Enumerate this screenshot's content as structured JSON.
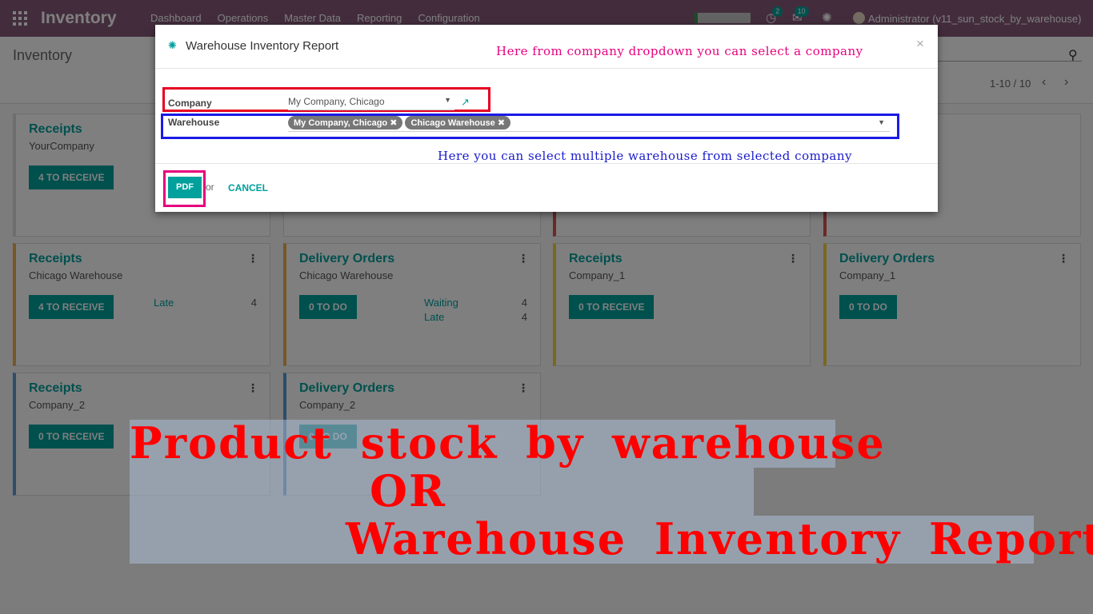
{
  "navbar": {
    "app_title": "Inventory",
    "menu": [
      "Dashboard",
      "Operations",
      "Master Data",
      "Reporting",
      "Configuration"
    ],
    "activity_count": "2",
    "message_count": "10",
    "user": "Administrator (v11_sun_stock_by_warehouse)"
  },
  "control_panel": {
    "breadcrumb": "Inventory",
    "pager": "1-10 / 10"
  },
  "cards": [
    {
      "title": "Receipts",
      "subtitle": "YourCompany",
      "button": "4 TO RECEIVE",
      "stats": []
    },
    {
      "title": "Receipts",
      "subtitle": "Chicago Warehouse",
      "button": "4 TO RECEIVE",
      "stats": [
        {
          "label": "Late",
          "value": "4"
        }
      ]
    },
    {
      "title": "Delivery Orders",
      "subtitle": "Chicago Warehouse",
      "button": "0 TO DO",
      "stats": [
        {
          "label": "Waiting",
          "value": "4"
        },
        {
          "label": "Late",
          "value": "4"
        }
      ]
    },
    {
      "title": "Receipts",
      "subtitle": "Company_1",
      "button": "0 TO RECEIVE",
      "stats": []
    },
    {
      "title": "Delivery Orders",
      "subtitle": "Company_1",
      "button": "0 TO DO",
      "stats": []
    },
    {
      "title": "Receipts",
      "subtitle": "Company_2",
      "button": "0 TO RECEIVE",
      "stats": []
    },
    {
      "title": "Delivery Orders",
      "subtitle": "Company_2",
      "button": "0 TO DO",
      "stats": []
    }
  ],
  "dialog": {
    "title": "Warehouse Inventory Report",
    "company_label": "Company",
    "company_value": "My Company, Chicago",
    "warehouse_label": "Warehouse",
    "warehouse_tags": [
      "My Company, Chicago",
      "Chicago Warehouse"
    ],
    "pdf_button": "PDF",
    "or_text": "or",
    "cancel_button": "CANCEL"
  },
  "annotations": {
    "company_note": "Here from company dropdown you can select a company",
    "warehouse_note": "Here you can select multiple warehouse from selected company",
    "banner_line1": "Product stock by warehouse",
    "banner_line2": "OR",
    "banner_line3": "Warehouse Inventory Report",
    "company_note_color": "#e6007e",
    "warehouse_note_color": "#1a1acc",
    "banner_color": "#ff0000"
  },
  "colors": {
    "navbar": "#875a7b",
    "accent": "#00a09d"
  }
}
